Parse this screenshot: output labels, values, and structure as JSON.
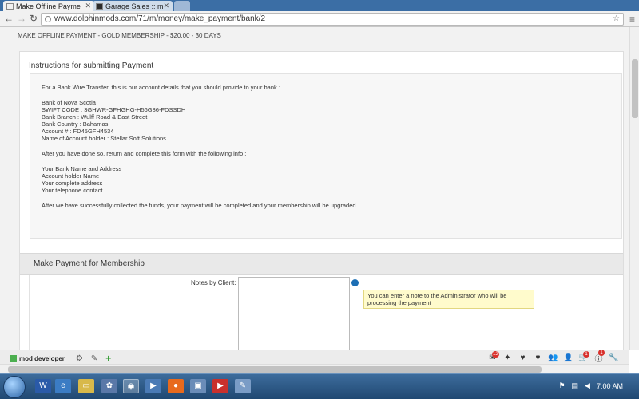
{
  "browser": {
    "tabs": [
      {
        "label": "Make Offline Payme",
        "active": true
      },
      {
        "label": "Garage Sales :: mod",
        "active": false
      }
    ],
    "url": "www.dolphinmods.com/71/m/money/make_payment/bank/2"
  },
  "page": {
    "title": "MAKE OFFLINE PAYMENT - GOLD MEMBERSHIP - $20.00 - 30 DAYS",
    "instructions_heading": "Instructions for submitting Payment",
    "instructions": [
      "For a Bank Wire Transfer, this is our account details that you should provide to your bank :",
      "Bank of Nova Scotia",
      "SWIFT CODE : 3GHWR-GFHGHG-H56G86-FDSSDH",
      "Bank Branch : Wulff Road & East Street",
      "Bank Country : Bahamas",
      "Account # : FD45GFH4534",
      "Name of Account holder : Stellar Soft Solutions",
      "After you have done so, return and complete this form with the following info :",
      "Your Bank Name and Address",
      "Account holder Name",
      "Your complete address",
      "Your telephone contact",
      "After we have successfully collected the funds, your payment will be completed and your membership will be upgraded."
    ],
    "form_heading": "Make Payment for Membership",
    "notes_label": "Notes by Client:",
    "notes_value": "",
    "notes_tooltip": "You can enter a note to the Administrator who will be processing the payment"
  },
  "dev_bar": {
    "user_name": "mod developer",
    "badges": {
      "mail": "12",
      "cart": "1",
      "info": "1"
    }
  },
  "taskbar": {
    "time": "7:00 AM"
  }
}
